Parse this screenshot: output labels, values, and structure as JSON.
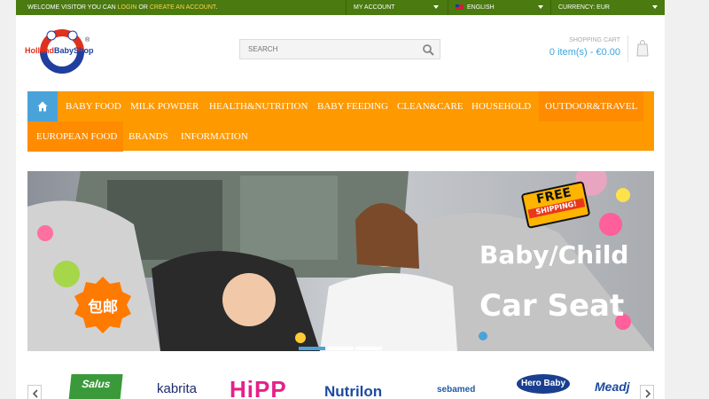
{
  "topbar": {
    "welcome_prefix": "WELCOME VISITOR YOU CAN",
    "login": "LOGIN",
    "or": "OR",
    "create_account": "CREATE AN ACCOUNT",
    "period": ".",
    "my_account": "MY ACCOUNT",
    "language": "ENGLISH",
    "currency": "CURRENCY: EUR"
  },
  "logo": {
    "part1": "Holland",
    "part2": "BabyShop",
    "reg": "®"
  },
  "search": {
    "placeholder": "SEARCH"
  },
  "cart": {
    "label": "SHOPPING CART",
    "summary": "0 item(s) - €0.00"
  },
  "nav": {
    "row1": [
      "BABY FOOD",
      "MILK POWDER",
      "HEALTH&NUTRITION",
      "BABY FEEDING",
      "CLEAN&CARE",
      "HOUSEHOLD",
      "OUTDOOR&TRAVEL"
    ],
    "row2": [
      "EUROPEAN FOOD",
      "BRANDS",
      "INFORMATION"
    ]
  },
  "banner": {
    "line1": "Baby/Child",
    "line2": "Car Seat",
    "free_shipping_1": "FREE",
    "free_shipping_2": "SHIPPING!",
    "stamp": "包邮",
    "slides": 3,
    "active_slide": 1
  },
  "brands": [
    "Salus",
    "kabrita",
    "HiPP",
    "Nutrilon",
    "sebamed",
    "Hero Baby",
    "Meadjohnson"
  ],
  "colors": {
    "topbar": "#4a7a10",
    "nav": "#ff9900",
    "home": "#4aa3d8",
    "accent_link": "#3aa6d8"
  }
}
